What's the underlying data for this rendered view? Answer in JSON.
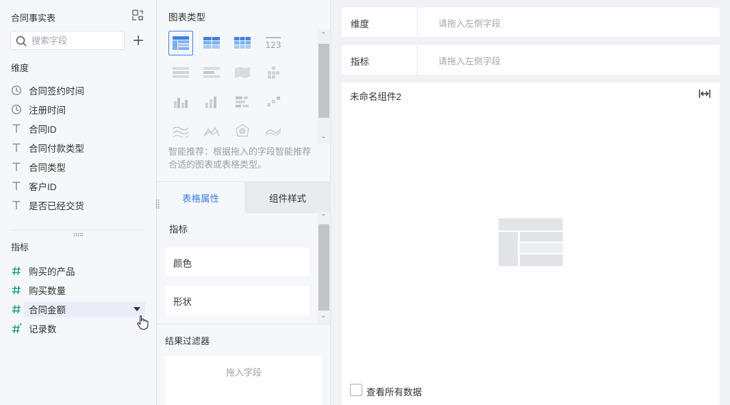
{
  "left_panel": {
    "dataset_title": "合同事实表",
    "search_placeholder": "搜索字段",
    "dimension_label": "维度",
    "dimensions": [
      {
        "label": "合同签约时间",
        "type": "date"
      },
      {
        "label": "注册时间",
        "type": "date"
      },
      {
        "label": "合同ID",
        "type": "text"
      },
      {
        "label": "合同付款类型",
        "type": "text"
      },
      {
        "label": "合同类型",
        "type": "text"
      },
      {
        "label": "客户ID",
        "type": "text"
      },
      {
        "label": "是否已经交货",
        "type": "text"
      }
    ],
    "measure_label": "指标",
    "measures": [
      {
        "label": "购买的产品",
        "type": "number"
      },
      {
        "label": "购买数量",
        "type": "number"
      },
      {
        "label": "合同金额",
        "type": "number",
        "active": true
      },
      {
        "label": "记录数",
        "type": "count"
      }
    ]
  },
  "middle_panel": {
    "chart_type_title": "图表类型",
    "selected_chart_type": "grouped-table",
    "recommend_hint": "智能推荐：根据拖入的字段智能推荐合适的图表或表格类型。",
    "tabs": [
      {
        "label": "表格属性",
        "active": true
      },
      {
        "label": "组件样式",
        "active": false
      }
    ],
    "measure_section_label": "指标",
    "properties": [
      "颜色",
      "形状"
    ],
    "result_filter_title": "结果过滤器",
    "drop_field_placeholder": "拖入字段"
  },
  "canvas": {
    "dimension_shelf_label": "维度",
    "measure_shelf_label": "指标",
    "shelf_placeholder": "请拖入左侧字段",
    "widget_title": "未命名组件2",
    "view_all_data_label": "查看所有数据",
    "view_all_data_checked": false
  },
  "colors": {
    "accent": "#3b7de0",
    "icon_gray": "#7f8a99",
    "teal_hash": "#1a9e8f",
    "panel_bg": "#f5f7fa"
  }
}
